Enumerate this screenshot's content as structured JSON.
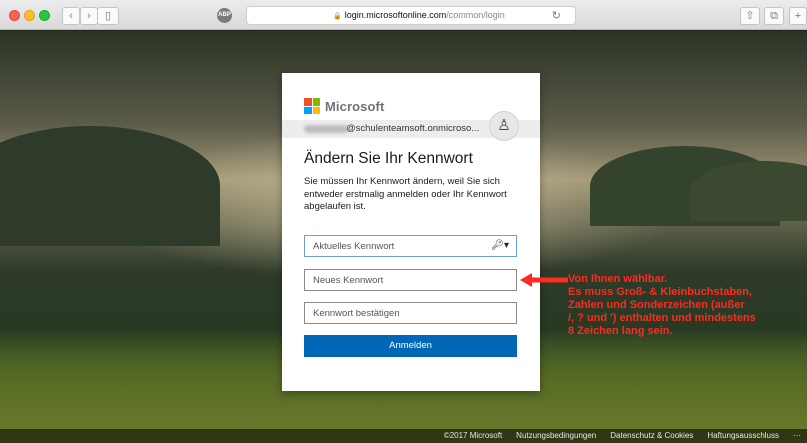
{
  "browser": {
    "url_domain": "login.microsoftonline.com",
    "url_path": "/common/login",
    "ext_icon_label": "ABP"
  },
  "card": {
    "brand": "Microsoft",
    "identity": "@schulenteamsoft.onmicroso...",
    "title": "Ändern Sie Ihr Kennwort",
    "description": "Sie müssen Ihr Kennwort ändern, weil Sie sich entweder erstmalig anmelden oder Ihr Kennwort abgelaufen ist.",
    "current_password_placeholder": "Aktuelles Kennwort",
    "new_password_placeholder": "Neues Kennwort",
    "confirm_password_placeholder": "Kennwort bestätigen",
    "submit_label": "Anmelden"
  },
  "annotation": {
    "line1": "Von Ihnen wählbar.",
    "line2": "Es muss Groß- & Kleinbuchstaben,",
    "line3": "Zahlen und Sonderzeichen (außer",
    "line4": "/, ? und ') enthalten und mindestens",
    "line5": "8 Zeichen lang sein.",
    "color": "#ff2a1f"
  },
  "footer": {
    "copyright": "©2017 Microsoft",
    "terms": "Nutzungsbedingungen",
    "privacy": "Datenschutz & Cookies",
    "disclaimer": "Haftungsausschluss",
    "more": "···"
  },
  "colors": {
    "accent": "#0067b8"
  }
}
